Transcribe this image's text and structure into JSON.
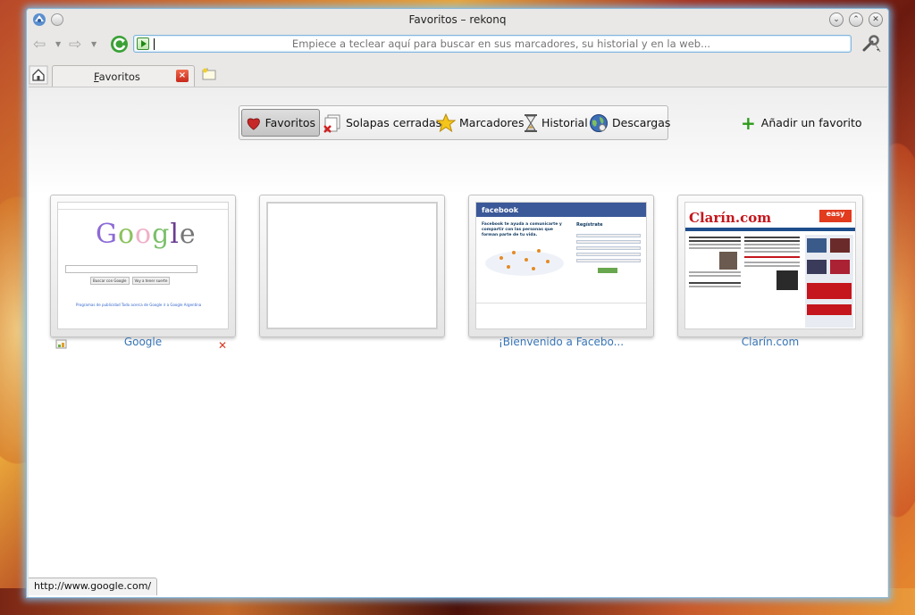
{
  "window": {
    "title": "Favoritos – rekonq"
  },
  "toolbar": {
    "url_placeholder": "Empiece a teclear aquí para buscar en sus marcadores, su historial y en la web..."
  },
  "tabs": [
    {
      "label": "Favoritos",
      "accesskey_char": "F",
      "rest": "avoritos"
    }
  ],
  "newtab_nav": {
    "items": [
      {
        "label": "Favoritos",
        "icon": "heart-icon",
        "active": true
      },
      {
        "label": "Solapas cerradas",
        "icon": "closed-tabs-icon"
      },
      {
        "label": "Marcadores",
        "icon": "star-icon"
      },
      {
        "label": "Historial",
        "icon": "hourglass-icon"
      },
      {
        "label": "Descargas",
        "icon": "globe-download-icon"
      }
    ],
    "add_favorite": "Añadir un favorito"
  },
  "favorites": [
    {
      "title": "Google",
      "kind": "google"
    },
    {
      "title": "",
      "kind": "empty"
    },
    {
      "title": "¡Bienvenido a Facebo...",
      "kind": "facebook"
    },
    {
      "title": "Clarín.com",
      "kind": "clarin"
    }
  ],
  "thumb_text": {
    "google_logo": "Google",
    "google_btn1": "Buscar con Google",
    "google_btn2": "Voy a tener suerte",
    "google_links": "Programas de publicidad   Todo acerca de Google   ir a Google Argentina",
    "fb_logo": "facebook",
    "fb_tagline": "Facebook te ayuda a comunicarte y compartir con las personas que forman parte de tu vida.",
    "fb_signup": "Regístrate",
    "clarin_logo": "Clarín.com",
    "clarin_easy": "easy"
  },
  "status": {
    "url": "http://www.google.com/"
  },
  "colors": {
    "accent_link": "#3774b5",
    "add_green": "#2c9a19",
    "close_red": "#d93a22"
  }
}
